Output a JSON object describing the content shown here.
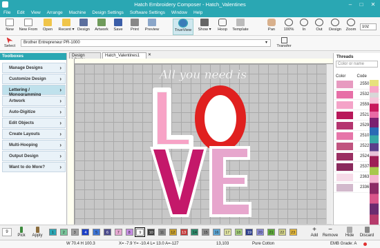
{
  "window": {
    "title": "Hatch Embroidery Composer - Hatch_Valentines"
  },
  "menu": [
    "File",
    "Edit",
    "View",
    "Arrange",
    "Machine",
    "Design Settings",
    "Software Settings",
    "Window",
    "Help"
  ],
  "toolbar": [
    {
      "label": "New",
      "icon": "new-file-icon"
    },
    {
      "label": "New From",
      "icon": "new-from-icon"
    },
    {
      "label": "Open",
      "icon": "folder-open-icon"
    },
    {
      "label": "Recent ▾",
      "icon": "recent-icon"
    },
    {
      "label": "Design",
      "icon": "design-icon"
    },
    {
      "label": "Artwork",
      "icon": "artwork-icon"
    },
    {
      "label": "Save",
      "icon": "save-icon"
    },
    {
      "label": "Print",
      "icon": "print-icon"
    },
    {
      "label": "Preview",
      "icon": "preview-icon"
    },
    {
      "label": "TrueView",
      "icon": "eye-icon"
    },
    {
      "label": "Show ▾",
      "icon": "show-icon"
    },
    {
      "label": "Hoop",
      "icon": "hoop-icon"
    },
    {
      "label": "Template",
      "icon": "template-icon"
    },
    {
      "label": "Pan",
      "icon": "pan-hand-icon"
    },
    {
      "label": "100%",
      "icon": "zoom-100-icon"
    },
    {
      "label": "In",
      "icon": "zoom-in-icon"
    },
    {
      "label": "Out",
      "icon": "zoom-out-icon"
    },
    {
      "label": "Design",
      "icon": "zoom-design-icon"
    },
    {
      "label": "Zoom",
      "icon": "zoom-icon"
    }
  ],
  "zoom_value": "102",
  "select_label": "Select",
  "machine_value": "Brother Entrepreneur PR-1000",
  "transfer_label": "Transfer",
  "toolbox": {
    "title": "Toolboxes",
    "items": [
      "Manage Designs",
      "Customize Design",
      "Lettering / Monogramming",
      "Artwork",
      "Auto-Digitize",
      "Edit Objects",
      "Create Layouts",
      "Multi-Hooping",
      "Output Design",
      "Want to do More?"
    ],
    "selected_index": 2
  },
  "doc_tabs": [
    "Design Library",
    "Hatch_Valentines1"
  ],
  "design": {
    "script_text": "All you need is",
    "letters": [
      "L",
      "O",
      "V",
      "E"
    ]
  },
  "threads": {
    "title": "Threads",
    "search_placeholder": "Color or name",
    "col_color": "Color",
    "col_code": "Code",
    "rows": [
      {
        "code": "2550",
        "color": "#e79ac0"
      },
      {
        "code": "2532",
        "color": "#e76fa7"
      },
      {
        "code": "2559",
        "color": "#f4a3c8"
      },
      {
        "code": "2521",
        "color": "#b8185a"
      },
      {
        "code": "2529",
        "color": "#b4356f"
      },
      {
        "code": "2510",
        "color": "#e676a9"
      },
      {
        "code": "2522",
        "color": "#c0547f"
      },
      {
        "code": "2524",
        "color": "#9a2f62"
      },
      {
        "code": "2537",
        "color": "#8a2a5d"
      },
      {
        "code": "2363",
        "color": "#f6dbe8"
      },
      {
        "code": "2336",
        "color": "#d2b9cc"
      }
    ]
  },
  "bottom_tools": [
    {
      "label": "Pick",
      "icon": "eyedropper-icon"
    },
    {
      "label": "Apply",
      "icon": "paint-apply-icon"
    },
    {
      "label": "Add",
      "icon": "add-icon"
    },
    {
      "label": "Remove",
      "icon": "remove-icon"
    },
    {
      "label": "Hide",
      "icon": "hide-icon"
    },
    {
      "label": "Discard",
      "icon": "trash-icon"
    }
  ],
  "color_count": "9",
  "color_chips": [
    {
      "n": "1",
      "c": "#2ba7b5"
    },
    {
      "n": "2",
      "c": "#79c59b"
    },
    {
      "n": "3",
      "c": "#a0a0a0"
    },
    {
      "n": "4",
      "c": "#1a3ec8"
    },
    {
      "n": "5",
      "c": "#3c74d6"
    },
    {
      "n": "6",
      "c": "#4a4a8c"
    },
    {
      "n": "7",
      "c": "#e5a8d1"
    },
    {
      "n": "8",
      "c": "#c58de2"
    },
    {
      "n": "9",
      "c": "#ffffff"
    },
    {
      "n": "10",
      "c": "#3b3b3b"
    },
    {
      "n": "11",
      "c": "#8a8a8a"
    },
    {
      "n": "12",
      "c": "#c9a02b"
    },
    {
      "n": "13",
      "c": "#c43a3a"
    },
    {
      "n": "14",
      "c": "#2b8a6a"
    },
    {
      "n": "15",
      "c": "#8d8d8d"
    },
    {
      "n": "16",
      "c": "#5aa6d6"
    },
    {
      "n": "17",
      "c": "#e3e6a3"
    },
    {
      "n": "18",
      "c": "#a7d37d"
    },
    {
      "n": "19",
      "c": "#2a3c8b"
    },
    {
      "n": "20",
      "c": "#8a8ad8"
    },
    {
      "n": "21",
      "c": "#5fae3a"
    },
    {
      "n": "22",
      "c": "#d5d58a"
    },
    {
      "n": "23",
      "c": "#e6b93a"
    }
  ],
  "selected_chip": "9",
  "status": {
    "size": "W 70.4 H 100.3",
    "coords": "X= -7.9 Y= -10.4 L= 13.0 A=-127",
    "stitches": "13,103",
    "fabric": "Pure Cotton",
    "emb_grade": "EMB Grade: A"
  }
}
